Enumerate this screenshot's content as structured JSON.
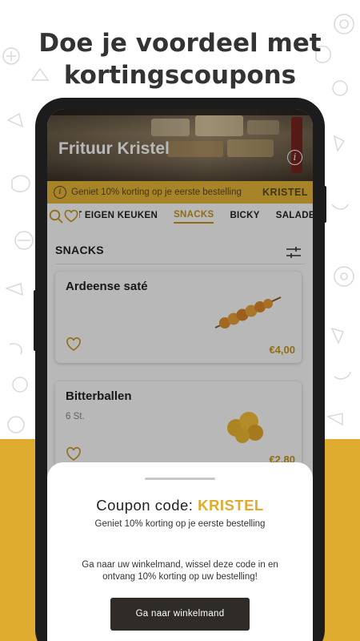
{
  "headline": {
    "line1": "Doe je voordeel met",
    "line2": "kortingscoupons"
  },
  "shop": {
    "name": "Frituur Kristel",
    "info_icon": "info-icon"
  },
  "promo": {
    "text": "Geniet 10% korting op je eerste bestelling",
    "code": "KRISTEL"
  },
  "tabs": {
    "icons": [
      "search-icon",
      "heart-icon"
    ],
    "items": [
      {
        "label": "UIT EIGEN KEUKEN",
        "active": false
      },
      {
        "label": "SNACKS",
        "active": true
      },
      {
        "label": "BICKY",
        "active": false
      },
      {
        "label": "SALADE",
        "active": false
      }
    ]
  },
  "section": {
    "title": "SNACKS",
    "filter_icon": "filter-sliders-icon"
  },
  "products": [
    {
      "name": "Ardeense saté",
      "subtitle": "",
      "price": "€4,00",
      "favorite": false
    },
    {
      "name": "Bitterballen",
      "subtitle": "6 St.",
      "price": "€2,80",
      "favorite": false
    }
  ],
  "coupon_sheet": {
    "label": "Coupon code:",
    "code": "KRISTEL",
    "subtitle": "Geniet 10% korting op je eerste bestelling",
    "body": "Ga naar uw winkelmand, wissel deze code in en ontvang 10% korting op uw bestelling!",
    "button_label": "Ga naar winkelmand"
  },
  "colors": {
    "accent": "#e0ac2f",
    "promo_bar": "#e8b836",
    "price": "#c9961c",
    "dark_button": "#2f2b26"
  }
}
